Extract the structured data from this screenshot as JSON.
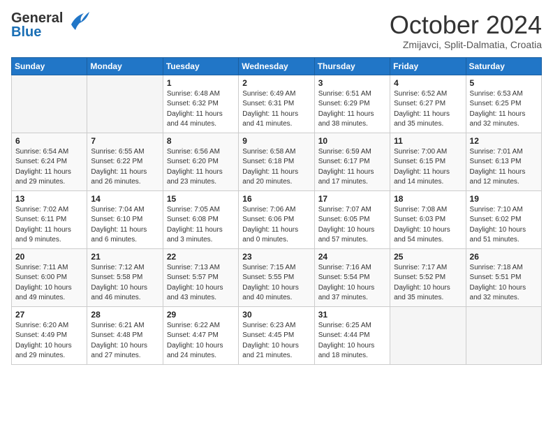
{
  "header": {
    "logo": {
      "general": "General",
      "blue": "Blue"
    },
    "title": "October 2024",
    "subtitle": "Zmijavci, Split-Dalmatia, Croatia"
  },
  "days_of_week": [
    "Sunday",
    "Monday",
    "Tuesday",
    "Wednesday",
    "Thursday",
    "Friday",
    "Saturday"
  ],
  "weeks": [
    [
      {
        "day": "",
        "info": ""
      },
      {
        "day": "",
        "info": ""
      },
      {
        "day": "1",
        "info": "Sunrise: 6:48 AM\nSunset: 6:32 PM\nDaylight: 11 hours\nand 44 minutes."
      },
      {
        "day": "2",
        "info": "Sunrise: 6:49 AM\nSunset: 6:31 PM\nDaylight: 11 hours\nand 41 minutes."
      },
      {
        "day": "3",
        "info": "Sunrise: 6:51 AM\nSunset: 6:29 PM\nDaylight: 11 hours\nand 38 minutes."
      },
      {
        "day": "4",
        "info": "Sunrise: 6:52 AM\nSunset: 6:27 PM\nDaylight: 11 hours\nand 35 minutes."
      },
      {
        "day": "5",
        "info": "Sunrise: 6:53 AM\nSunset: 6:25 PM\nDaylight: 11 hours\nand 32 minutes."
      }
    ],
    [
      {
        "day": "6",
        "info": "Sunrise: 6:54 AM\nSunset: 6:24 PM\nDaylight: 11 hours\nand 29 minutes."
      },
      {
        "day": "7",
        "info": "Sunrise: 6:55 AM\nSunset: 6:22 PM\nDaylight: 11 hours\nand 26 minutes."
      },
      {
        "day": "8",
        "info": "Sunrise: 6:56 AM\nSunset: 6:20 PM\nDaylight: 11 hours\nand 23 minutes."
      },
      {
        "day": "9",
        "info": "Sunrise: 6:58 AM\nSunset: 6:18 PM\nDaylight: 11 hours\nand 20 minutes."
      },
      {
        "day": "10",
        "info": "Sunrise: 6:59 AM\nSunset: 6:17 PM\nDaylight: 11 hours\nand 17 minutes."
      },
      {
        "day": "11",
        "info": "Sunrise: 7:00 AM\nSunset: 6:15 PM\nDaylight: 11 hours\nand 14 minutes."
      },
      {
        "day": "12",
        "info": "Sunrise: 7:01 AM\nSunset: 6:13 PM\nDaylight: 11 hours\nand 12 minutes."
      }
    ],
    [
      {
        "day": "13",
        "info": "Sunrise: 7:02 AM\nSunset: 6:11 PM\nDaylight: 11 hours\nand 9 minutes."
      },
      {
        "day": "14",
        "info": "Sunrise: 7:04 AM\nSunset: 6:10 PM\nDaylight: 11 hours\nand 6 minutes."
      },
      {
        "day": "15",
        "info": "Sunrise: 7:05 AM\nSunset: 6:08 PM\nDaylight: 11 hours\nand 3 minutes."
      },
      {
        "day": "16",
        "info": "Sunrise: 7:06 AM\nSunset: 6:06 PM\nDaylight: 11 hours\nand 0 minutes."
      },
      {
        "day": "17",
        "info": "Sunrise: 7:07 AM\nSunset: 6:05 PM\nDaylight: 10 hours\nand 57 minutes."
      },
      {
        "day": "18",
        "info": "Sunrise: 7:08 AM\nSunset: 6:03 PM\nDaylight: 10 hours\nand 54 minutes."
      },
      {
        "day": "19",
        "info": "Sunrise: 7:10 AM\nSunset: 6:02 PM\nDaylight: 10 hours\nand 51 minutes."
      }
    ],
    [
      {
        "day": "20",
        "info": "Sunrise: 7:11 AM\nSunset: 6:00 PM\nDaylight: 10 hours\nand 49 minutes."
      },
      {
        "day": "21",
        "info": "Sunrise: 7:12 AM\nSunset: 5:58 PM\nDaylight: 10 hours\nand 46 minutes."
      },
      {
        "day": "22",
        "info": "Sunrise: 7:13 AM\nSunset: 5:57 PM\nDaylight: 10 hours\nand 43 minutes."
      },
      {
        "day": "23",
        "info": "Sunrise: 7:15 AM\nSunset: 5:55 PM\nDaylight: 10 hours\nand 40 minutes."
      },
      {
        "day": "24",
        "info": "Sunrise: 7:16 AM\nSunset: 5:54 PM\nDaylight: 10 hours\nand 37 minutes."
      },
      {
        "day": "25",
        "info": "Sunrise: 7:17 AM\nSunset: 5:52 PM\nDaylight: 10 hours\nand 35 minutes."
      },
      {
        "day": "26",
        "info": "Sunrise: 7:18 AM\nSunset: 5:51 PM\nDaylight: 10 hours\nand 32 minutes."
      }
    ],
    [
      {
        "day": "27",
        "info": "Sunrise: 6:20 AM\nSunset: 4:49 PM\nDaylight: 10 hours\nand 29 minutes."
      },
      {
        "day": "28",
        "info": "Sunrise: 6:21 AM\nSunset: 4:48 PM\nDaylight: 10 hours\nand 27 minutes."
      },
      {
        "day": "29",
        "info": "Sunrise: 6:22 AM\nSunset: 4:47 PM\nDaylight: 10 hours\nand 24 minutes."
      },
      {
        "day": "30",
        "info": "Sunrise: 6:23 AM\nSunset: 4:45 PM\nDaylight: 10 hours\nand 21 minutes."
      },
      {
        "day": "31",
        "info": "Sunrise: 6:25 AM\nSunset: 4:44 PM\nDaylight: 10 hours\nand 18 minutes."
      },
      {
        "day": "",
        "info": ""
      },
      {
        "day": "",
        "info": ""
      }
    ]
  ]
}
